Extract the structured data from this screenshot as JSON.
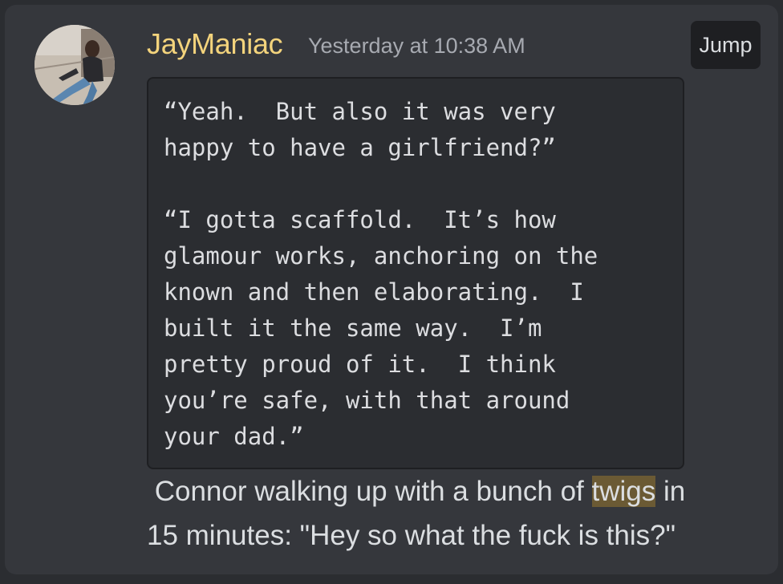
{
  "message": {
    "author": "JayManiac",
    "timestamp": "Yesterday at 10:38 AM",
    "jump_label": "Jump",
    "code_lines": [
      "“Yeah.  But also it was very",
      "happy to have a girlfriend?”",
      "",
      "“I gotta scaffold.  It’s how",
      "glamour works, anchoring on the",
      "known and then elaborating.  I",
      "built it the same way.  I’m",
      "pretty proud of it.  I think",
      "you’re safe, with that around",
      "your dad.”"
    ],
    "text_line1_before": " Connor walking up with a bunch of ",
    "text_highlight": "twigs",
    "text_line1_after": " in",
    "text_line2": "15 minutes: \"Hey so what the fuck is this?\""
  },
  "colors": {
    "background": "#2b2d31",
    "card": "#35373c",
    "username": "#f3d37c",
    "highlight": "#6b5a34"
  },
  "icons": {
    "avatar": "user-avatar-photo"
  }
}
